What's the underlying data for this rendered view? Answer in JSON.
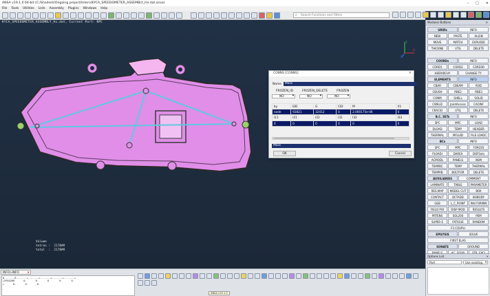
{
  "window": {
    "title": "ANSA v19.1.0 64-bit (C:/Shailesh/Ongoing project/Intern/KYCA_SPEEDOMETER_ASSEMBLY_Hx.dat.ansa)"
  },
  "menu": [
    "File",
    "Tools",
    "Utilities",
    "Lists",
    "Assembly",
    "Plugins",
    "Windows",
    "Help"
  ],
  "search": {
    "placeholder": "Search Functions and Filters"
  },
  "viewport": {
    "header": "KYCA_SPEEDOMETER_ASSEMBLY_Hx.dat,  Current Part: NPC",
    "volume_label": "Volume",
    "tetras": "tetras :  2178##",
    "total": "total  :  2178##",
    "axes": {
      "x": "X",
      "y": "Y",
      "z": "Z"
    },
    "colors": {
      "body": "#e08ee8",
      "outline": "#2a2a2a",
      "edge": "#5fc9e0",
      "bg": "#1e2b3c"
    }
  },
  "dialog": {
    "title": "CONNS [CONNS]",
    "name_label": "Name",
    "name_value": "Mass",
    "headers": [
      "FROZEN_ID",
      "FROZEN_DELETE",
      "FROZEN"
    ],
    "dropdowns": [
      "NO",
      "NO",
      "NO"
    ],
    "table": {
      "cols": [
        "by",
        "EID",
        "G",
        "CID",
        "M",
        "X1"
      ],
      "row1": [
        "node",
        "92821",
        "32412",
        "0",
        "2.000175e-06",
        "0"
      ],
      "cols2": [
        "I11",
        "I21",
        "I22",
        "I31",
        "I32",
        "I33"
      ],
      "row2": [
        "0",
        "0",
        "0",
        "0",
        "0",
        "0"
      ]
    },
    "desc": "Mass",
    "ok": "OK",
    "cancel": "Cancel"
  },
  "rightpanel": {
    "title": "Modules Buttons",
    "groups": [
      [
        [
          "GRIDs",
          "hd"
        ],
        [
          "INFO",
          ""
        ]
      ],
      [
        [
          "NEW",
          ""
        ],
        [
          "PASTE",
          ""
        ],
        [
          "ALIGN",
          ""
        ]
      ],
      [
        [
          "MOVE",
          ""
        ],
        [
          "MATCH",
          ""
        ],
        [
          "EXPLODE",
          ""
        ]
      ],
      [
        [
          "THICKNE",
          ""
        ],
        [
          "UTIL",
          ""
        ],
        [
          "DELETE",
          ""
        ]
      ],
      [
        [
          "",
          ""
        ]
      ],
      [
        [
          "COORDs",
          "hd"
        ],
        [
          "INFO",
          ""
        ]
      ],
      [
        [
          "CORD1",
          ""
        ],
        [
          "CORD2",
          ""
        ],
        [
          "CORD3R",
          ""
        ]
      ],
      [
        [
          "HIERARCHY",
          ""
        ],
        [
          "CHANGE TY",
          ""
        ]
      ],
      [
        [
          "ELEMENTS",
          "hd"
        ],
        [
          "INFO",
          "act"
        ]
      ],
      [
        [
          "CBAR",
          ""
        ],
        [
          "CBEAM",
          ""
        ],
        [
          "ROD",
          ""
        ]
      ],
      [
        [
          "CBUSH",
          ""
        ],
        [
          "RBE2",
          ""
        ],
        [
          "RBE3",
          ""
        ]
      ],
      [
        [
          "CONM",
          ""
        ],
        [
          "SHELL",
          ""
        ],
        [
          "SOLID",
          ""
        ]
      ],
      [
        [
          "CWELD",
          ""
        ],
        [
          "JointAccess",
          ""
        ],
        [
          "CACINF",
          ""
        ]
      ],
      [
        [
          "CRACIO",
          ""
        ],
        [
          "UTIL",
          ""
        ],
        [
          "DELETE",
          ""
        ]
      ],
      [
        [
          "B.C. SETs",
          "hd"
        ],
        [
          "INFO",
          ""
        ]
      ],
      [
        [
          "SPC",
          ""
        ],
        [
          "MPC",
          ""
        ],
        [
          "LOAD",
          ""
        ]
      ],
      [
        [
          "DLOAD",
          ""
        ],
        [
          "TEMP",
          ""
        ],
        [
          "HEADER",
          ""
        ]
      ],
      [
        [
          "THERMAL",
          ""
        ],
        [
          "MFLUID",
          ""
        ],
        [
          "FILE LOADC",
          ""
        ]
      ],
      [
        [
          "BCs",
          "hd"
        ],
        [
          "INFO",
          ""
        ]
      ],
      [
        [
          "SPC",
          ""
        ],
        [
          "MPC",
          ""
        ],
        [
          "FORCES",
          ""
        ]
      ],
      [
        [
          "PLOADI",
          ""
        ],
        [
          "DAREA",
          ""
        ],
        [
          "DOFSets",
          ""
        ]
      ],
      [
        [
          "ACMODL",
          ""
        ],
        [
          "PANELS",
          ""
        ],
        [
          "NSM",
          ""
        ]
      ],
      [
        [
          "TEMPBC",
          ""
        ],
        [
          "TEMP",
          ""
        ],
        [
          "THERMAL",
          ""
        ]
      ],
      [
        [
          "TEMPRB",
          ""
        ],
        [
          "BOLTFOR",
          ""
        ],
        [
          "DELETE",
          ""
        ]
      ],
      [
        [
          "AUXILIARIES",
          "hd"
        ],
        [
          "COMMENT",
          ""
        ]
      ],
      [
        [
          "LAMINATE",
          ""
        ],
        [
          "TABLE",
          ""
        ],
        [
          "PARAMETER",
          ""
        ]
      ],
      [
        [
          "RES.MAP",
          ""
        ],
        [
          "MODEL CUT",
          ""
        ],
        [
          "BOX",
          ""
        ]
      ],
      [
        [
          "CONTACT",
          ""
        ],
        [
          "BCTADD",
          ""
        ],
        [
          "BOBODY",
          ""
        ]
      ],
      [
        [
          "GEB",
          ""
        ],
        [
          "L_C_POINT",
          ""
        ],
        [
          "INV.FORMIN",
          ""
        ]
      ],
      [
        [
          "FIELD POI",
          ""
        ],
        [
          "DISP MOD",
          ""
        ],
        [
          "RESULTS",
          ""
        ]
      ],
      [
        [
          "PRTENS",
          ""
        ],
        [
          "SOL200",
          ""
        ],
        [
          "PEM",
          ""
        ]
      ],
      [
        [
          "SUPER E",
          ""
        ],
        [
          "FATIGUE",
          ""
        ],
        [
          "RANDOM",
          ""
        ]
      ],
      [
        [
          "F3 COUPLI",
          ""
        ]
      ],
      [
        [
          "EPILYSIS",
          "hd"
        ],
        [
          "SOLVE",
          ""
        ]
      ],
      [
        [
          "FIRST ELAS",
          ""
        ]
      ],
      [
        [
          "SONATE",
          "hd"
        ],
        [
          "GROUND",
          ""
        ]
      ],
      [
        [
          "PANELS",
          ""
        ],
        [
          "AC. SOUR",
          ""
        ],
        [
          "STR. EXCI",
          ""
        ]
      ]
    ]
  },
  "options": {
    "title": "Options List",
    "field": "Part",
    "dropdown": "Use existing"
  },
  "info": {
    "tab": "INFO>INFO",
    "lines": "#-------0-------+-------+-------+-------+-------+\n+3954206      0.      0.      0.      0.      0.\n+      0.      0.      0.\n"
  },
  "tooltip": "ANSA v19.1.0"
}
